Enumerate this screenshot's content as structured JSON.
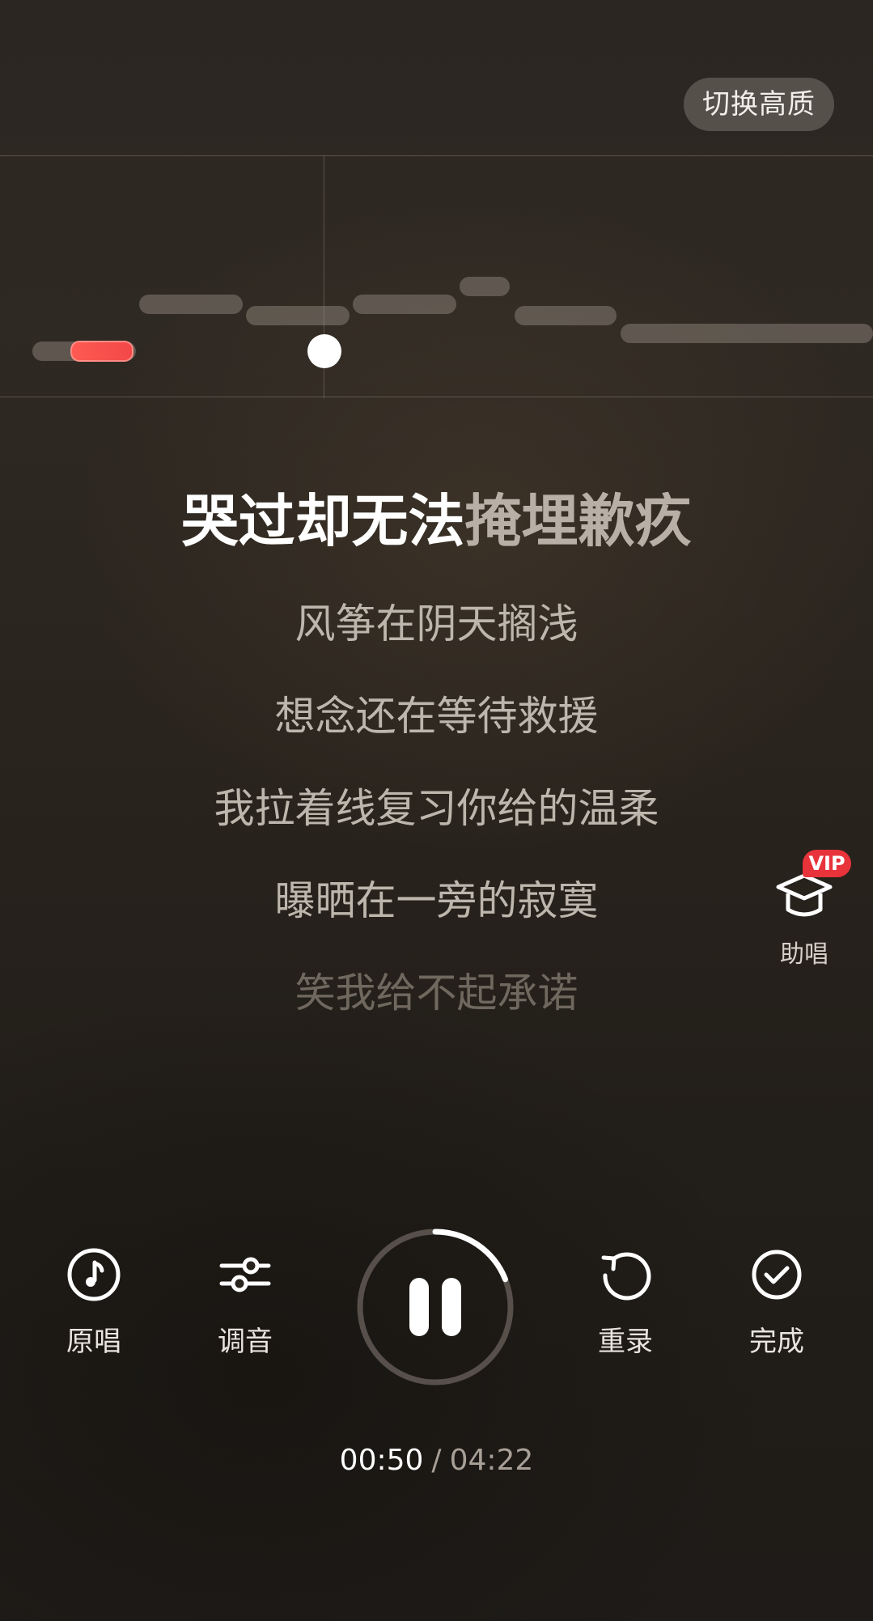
{
  "header": {
    "quality_button_label": "切换高质"
  },
  "pitch": {
    "sung_note_color": "#f24848"
  },
  "lyrics": {
    "current_sung": "哭过却无法",
    "current_unsung": "掩埋歉疚",
    "upcoming": [
      "风筝在阴天搁浅",
      "想念还在等待救援",
      "我拉着线复习你给的温柔",
      "曝晒在一旁的寂寞",
      "笑我给不起承诺"
    ]
  },
  "assist": {
    "badge": "VIP",
    "label": "助唱",
    "badge_color": "#e8333b"
  },
  "controls": {
    "original_label": "原唱",
    "tune_label": "调音",
    "rerecord_label": "重录",
    "done_label": "完成",
    "play_state": "paused-icon",
    "progress_fraction": 0.19
  },
  "time": {
    "elapsed": "00:50",
    "separator": "/",
    "total": "04:22"
  }
}
